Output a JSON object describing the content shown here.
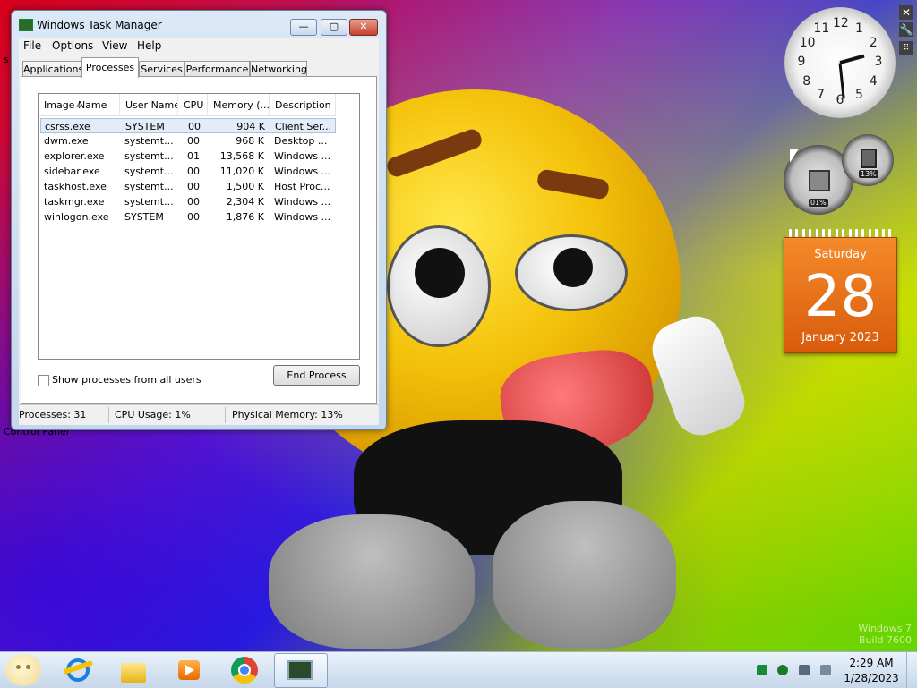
{
  "desktop": {
    "left_clip_label": "s",
    "control_panel_label": "Control Panel",
    "watermark_line1": "Windows 7",
    "watermark_line2": "Build 7600"
  },
  "task_manager": {
    "title": "Windows Task Manager",
    "controls": {
      "minimize": "—",
      "maximize": "▢",
      "close": "✕"
    },
    "menu": [
      "File",
      "Options",
      "View",
      "Help"
    ],
    "tabs": [
      "Applications",
      "Processes",
      "Services",
      "Performance",
      "Networking"
    ],
    "active_tab": "Processes",
    "columns": [
      "Image Name",
      "User Name",
      "CPU",
      "Memory (...",
      "Description"
    ],
    "processes": [
      {
        "name": "csrss.exe",
        "user": "SYSTEM",
        "cpu": "00",
        "memory": "904 K",
        "description": "Client Ser..."
      },
      {
        "name": "dwm.exe",
        "user": "systemt...",
        "cpu": "00",
        "memory": "968 K",
        "description": "Desktop ..."
      },
      {
        "name": "explorer.exe",
        "user": "systemt...",
        "cpu": "01",
        "memory": "13,568 K",
        "description": "Windows ..."
      },
      {
        "name": "sidebar.exe",
        "user": "systemt...",
        "cpu": "00",
        "memory": "11,020 K",
        "description": "Windows ..."
      },
      {
        "name": "taskhost.exe",
        "user": "systemt...",
        "cpu": "00",
        "memory": "1,500 K",
        "description": "Host Proc..."
      },
      {
        "name": "taskmgr.exe",
        "user": "systemt...",
        "cpu": "00",
        "memory": "2,304 K",
        "description": "Windows ..."
      },
      {
        "name": "winlogon.exe",
        "user": "SYSTEM",
        "cpu": "00",
        "memory": "1,876 K",
        "description": "Windows ..."
      }
    ],
    "selected_index": 0,
    "show_all_users_label": "Show processes from all users",
    "end_process_label": "End Process",
    "status": {
      "processes": "Processes: 31",
      "cpu": "CPU Usage: 1%",
      "memory": "Physical Memory: 13%"
    }
  },
  "gadgets": {
    "clock": {
      "numbers": [
        "12",
        "1",
        "2",
        "3",
        "4",
        "5",
        "6",
        "7",
        "8",
        "9",
        "10",
        "11"
      ],
      "hour": 2,
      "minute": 29
    },
    "meter": {
      "cpu_value": "01%",
      "memory_value": "13%"
    },
    "calendar": {
      "weekday": "Saturday",
      "day": "28",
      "month_year": "January 2023"
    },
    "tools": [
      "close-icon",
      "wrench-icon",
      "grip-icon"
    ]
  },
  "taskbar": {
    "pinned": [
      "internet-explorer-icon",
      "libraries-folder-icon",
      "media-player-icon",
      "chrome-icon",
      "task-manager-icon"
    ],
    "tray": {
      "time": "2:29 AM",
      "date": "1/28/2023"
    }
  },
  "colors": {
    "calendar_orange": "#e8701a",
    "selection": "#e3edf8"
  }
}
